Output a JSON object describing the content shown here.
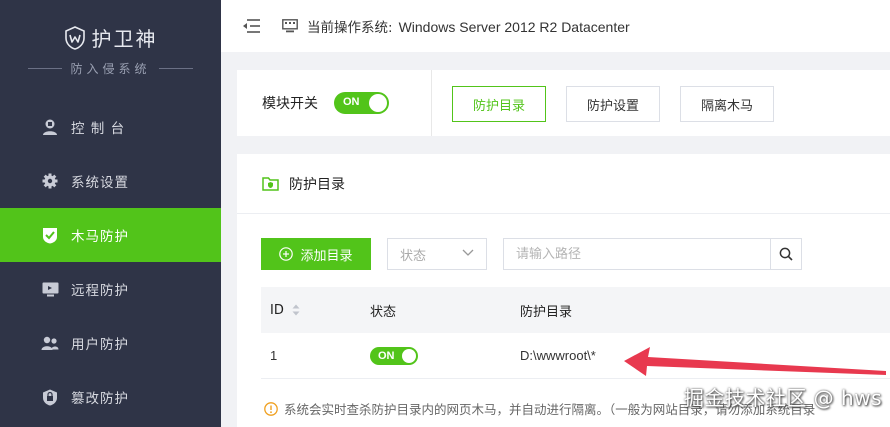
{
  "brand": {
    "title": "护卫神",
    "subtitle": "防入侵系统"
  },
  "sidebar": {
    "items": [
      {
        "label": "控 制 台",
        "icon": "user-shield-icon"
      },
      {
        "label": "系统设置",
        "icon": "gear-icon"
      },
      {
        "label": "木马防护",
        "icon": "shield-check-icon"
      },
      {
        "label": "远程防护",
        "icon": "monitor-icon"
      },
      {
        "label": "用户防护",
        "icon": "users-icon"
      },
      {
        "label": "篡改防护",
        "icon": "lock-icon"
      }
    ],
    "active_index": 2
  },
  "topbar": {
    "os_label": "当前操作系统:",
    "os_value": "Windows Server 2012 R2 Datacenter"
  },
  "module": {
    "label": "模块开关",
    "switch_text": "ON",
    "enabled": true
  },
  "tabs": [
    {
      "label": "防护目录",
      "active": true
    },
    {
      "label": "防护设置",
      "active": false
    },
    {
      "label": "隔离木马",
      "active": false
    }
  ],
  "panel": {
    "title": "防护目录"
  },
  "toolbar": {
    "add_label": "添加目录",
    "status_placeholder": "状态",
    "path_placeholder": "请输入路径"
  },
  "table": {
    "headers": {
      "id": "ID",
      "status": "状态",
      "dir": "防护目录"
    },
    "rows": [
      {
        "id": "1",
        "status": "ON",
        "dir": "D:\\wwwroot\\*"
      }
    ]
  },
  "note": "系统会实时查杀防护目录内的网页木马，并自动进行隔离。（一般为网站目录，请勿添加系统目录",
  "watermark": "掘金技术社区 @ hws",
  "colors": {
    "accent": "#52c41a",
    "sidebar_bg": "#2f3447",
    "annotation_arrow": "#e8394f"
  }
}
